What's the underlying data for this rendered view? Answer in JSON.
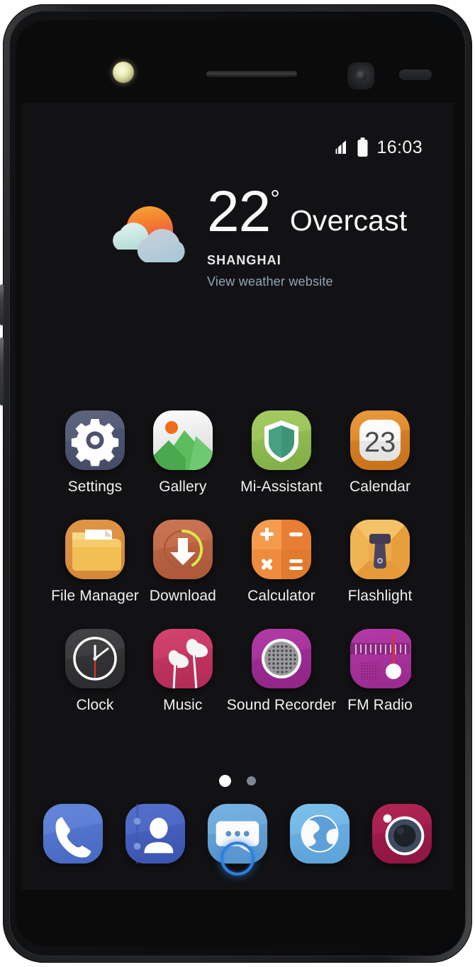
{
  "device": {
    "hardware": {
      "flash_led": "led-flash",
      "earpiece": "earpiece-speaker",
      "front_camera": "front-camera",
      "proximity_sensor": "proximity-sensor",
      "home_button": "home-button",
      "home_button_color": "#2d7fe0"
    }
  },
  "status_bar": {
    "signal_icon": "signal-bars-icon",
    "signal_bars": 4,
    "battery_icon": "battery-full-icon",
    "time": "16:03"
  },
  "weather": {
    "icon": "sun-behind-clouds-icon",
    "temperature": "22",
    "degree_symbol": "°",
    "condition": "Overcast",
    "city": "SHANGHAI",
    "link_label": "View weather website",
    "link_color": "#94a3b8"
  },
  "app_grid": {
    "rows": 3,
    "columns": 4,
    "apps": [
      {
        "label": "Settings",
        "icon": "gear-icon",
        "bg": "#545a72"
      },
      {
        "label": "Gallery",
        "icon": "mountains-photo-icon",
        "bg": "#e8e8e8"
      },
      {
        "label": "Mi-Assistant",
        "icon": "shield-icon",
        "bg": "#97c martin"
      },
      {
        "label": "Calendar",
        "icon": "calendar-23-icon",
        "bg": "#e08a2e"
      },
      {
        "label": "File Manager",
        "icon": "folder-document-icon",
        "bg": "#edb04a"
      },
      {
        "label": "Download",
        "icon": "download-arrow-icon",
        "bg": "#c4694a"
      },
      {
        "label": "Calculator",
        "icon": "calculator-icon",
        "bg": "#ef8a3c"
      },
      {
        "label": "Flashlight",
        "icon": "torch-icon",
        "bg": "#f0b košice"
      },
      {
        "label": "Clock",
        "icon": "analog-clock-icon",
        "bg": "#3a3a3c"
      },
      {
        "label": "Music",
        "icon": "earbuds-icon",
        "bg": "#c9386a"
      },
      {
        "label": "Sound Recorder",
        "icon": "microphone-icon",
        "bg": "#a8309b"
      },
      {
        "label": "FM Radio",
        "icon": "radio-tuner-icon",
        "bg": "#ad2fa0"
      }
    ]
  },
  "page_indicator": {
    "total_pages": 2,
    "active_page": 1
  },
  "dock": {
    "apps": [
      {
        "name": "Phone",
        "icon": "phone-handset-icon",
        "bg": "#5a7fd4"
      },
      {
        "name": "Contacts",
        "icon": "contacts-person-icon",
        "bg": "#4a64c0"
      },
      {
        "name": "Messages",
        "icon": "speech-bubble-icon",
        "bg": "#6aa8dc"
      },
      {
        "name": "Browser",
        "icon": "globe-icon",
        "bg": "#6ab4e8"
      },
      {
        "name": "Camera",
        "icon": "camera-lens-icon",
        "bg": "#a61e4d"
      }
    ]
  }
}
